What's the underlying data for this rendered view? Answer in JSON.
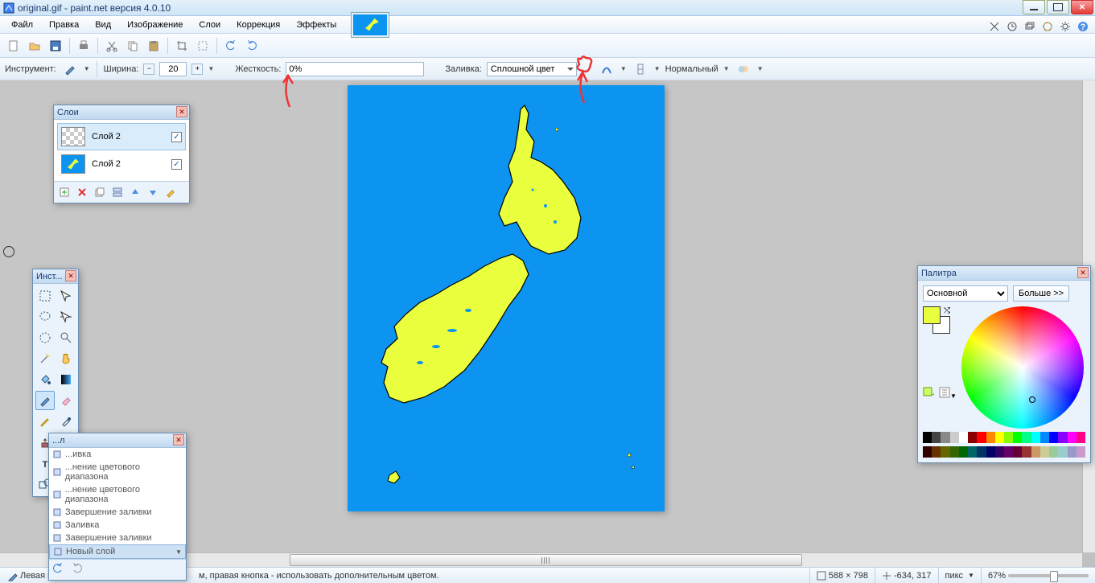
{
  "title": "original.gif - paint.net версия 4.0.10",
  "menu": [
    "Файл",
    "Правка",
    "Вид",
    "Изображение",
    "Слои",
    "Коррекция",
    "Эффекты"
  ],
  "right_icons": [
    "ruler-icon",
    "clock-icon",
    "layers-icon",
    "wheel-icon",
    "gear-icon",
    "help-icon"
  ],
  "toolopts": {
    "instrument_label": "Инструмент:",
    "width_label": "Ширина:",
    "width_value": "20",
    "hardness_label": "Жесткость:",
    "hardness_value": "0%",
    "fill_label": "Заливка:",
    "fill_value": "Сплошной цвет",
    "blend_label": "Нормальный"
  },
  "layers_panel": {
    "title": "Слои",
    "items": [
      {
        "name": "Слой 2",
        "sel": true,
        "thumb": "checker",
        "visible": true
      },
      {
        "name": "Слой 2",
        "sel": false,
        "thumb": "map",
        "visible": true
      }
    ]
  },
  "tools_panel": {
    "title": "Инст..."
  },
  "history_panel": {
    "title": "...л",
    "items": [
      {
        "label": "...ивка"
      },
      {
        "label": "...нение цветового диапазона"
      },
      {
        "label": "...нение цветового диапазона"
      },
      {
        "label": "Завершение заливки"
      },
      {
        "label": "Заливка"
      },
      {
        "label": "Завершение заливки"
      },
      {
        "label": "Новый слой",
        "sel": true
      }
    ]
  },
  "colors_panel": {
    "title": "Палитра",
    "mode": "Основной",
    "more": "Больше >>",
    "palette": [
      "#000",
      "#444",
      "#888",
      "#ccc",
      "#fff",
      "#800",
      "#f00",
      "#f80",
      "#ff0",
      "#8f0",
      "#0f0",
      "#0f8",
      "#0ff",
      "#08f",
      "#00f",
      "#80f",
      "#f0f",
      "#f08"
    ]
  },
  "status": {
    "hint_left": "Левая к",
    "hint_rest": "м, правая кнопка - использовать дополнительным цветом.",
    "dims": "588 × 798",
    "coords": "-634, 317",
    "unit": "пикс",
    "zoom": "67%"
  }
}
